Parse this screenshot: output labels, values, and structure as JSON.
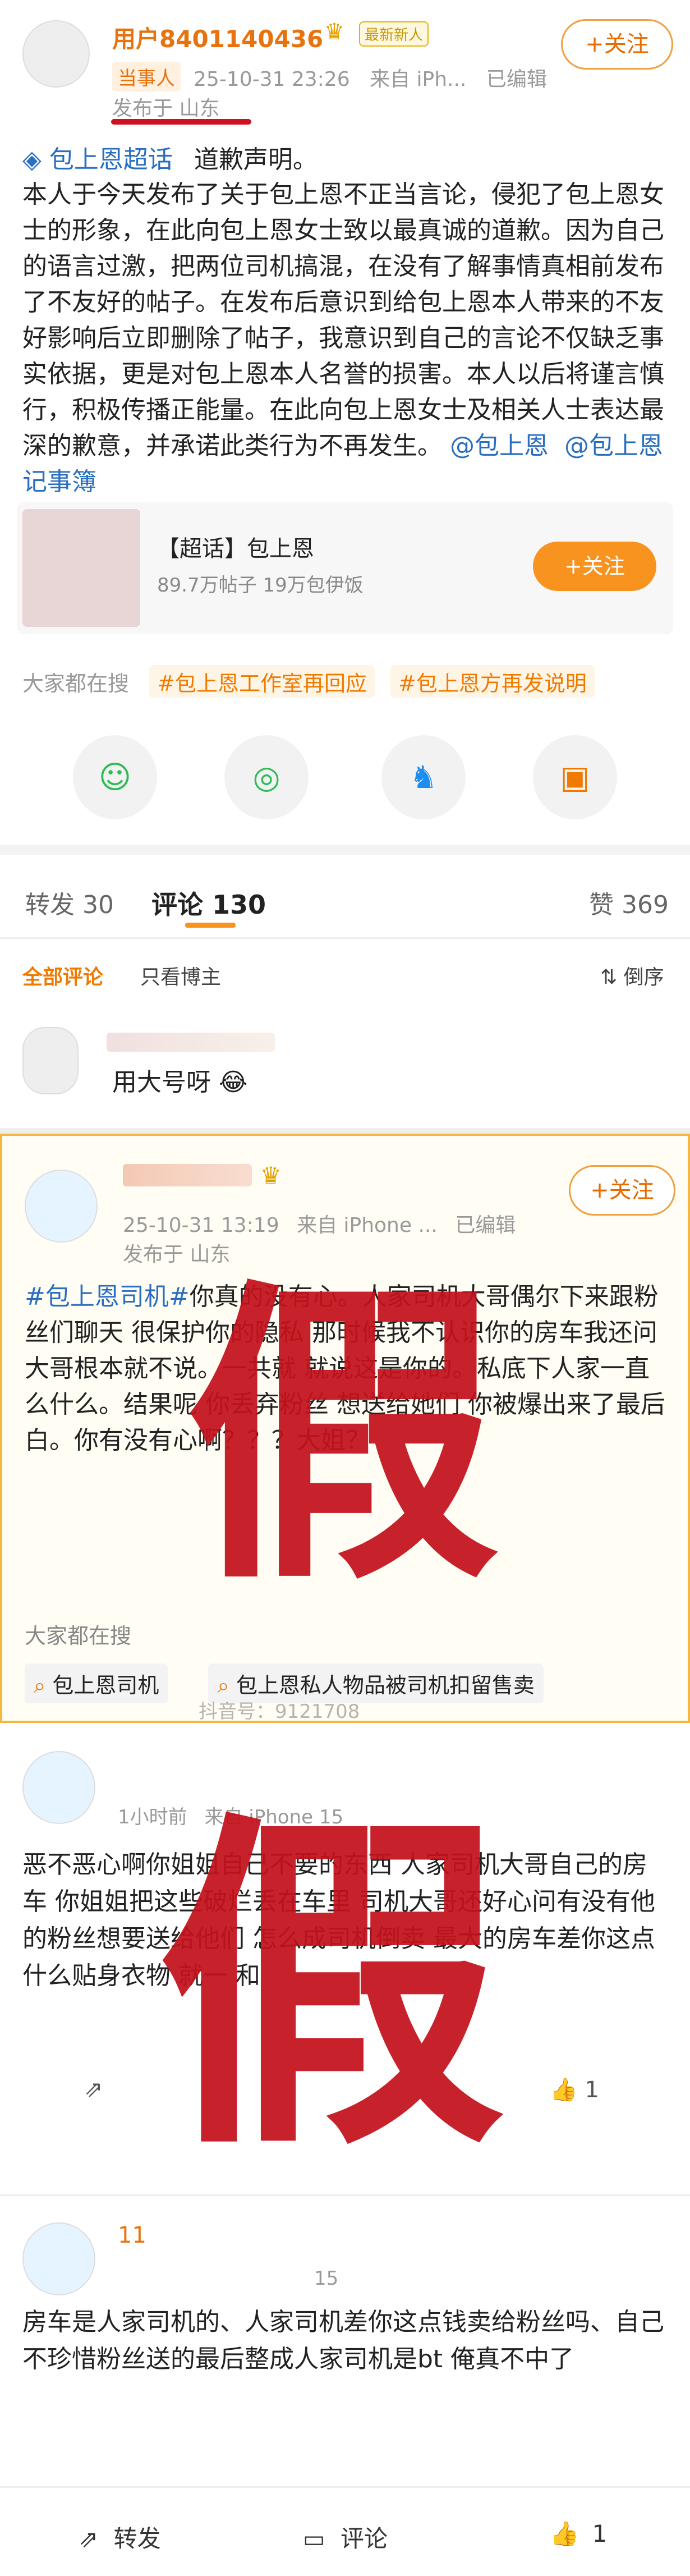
{
  "post": {
    "username": "用户8401140436",
    "user_badge_new": "最新新人",
    "role_tag": "当事人",
    "timestamp": "25-10-31 23:26",
    "source": "来自 iPh...",
    "edited": "已编辑",
    "location": "发布于 山东",
    "follow_label": "+关注",
    "supertopic_tag": "包上恩超话",
    "heading": "道歉声明。",
    "body": "本人于今天发布了关于包上恩不正当言论，侵犯了包上恩女士的形象，在此向包上恩女士致以最真诚的道歉。因为自己的语言过激，把两位司机搞混，在没有了解事情真相前发布了不友好的帖子。在发布后意识到给包上恩本人带来的不友好影响后立即删除了帖子，我意识到自己的言论不仅缺乏事实依据，更是对包上恩本人名誉的损害。本人以后将谨言慎行，积极传播正能量。在此向包上恩女士及相关人士表达最深的歉意，并承诺此类行为不再发生。",
    "mentions": [
      "@包上恩",
      "@包上恩记事簿"
    ],
    "card": {
      "title": "【超话】包上恩",
      "stats": "89.7万帖子 19万包伊饭",
      "follow_label": "+关注"
    },
    "trending_label": "大家都在搜",
    "trending_tags": [
      "#包上恩工作室再回应",
      "#包上恩方再发说明"
    ]
  },
  "tabs": {
    "repost": "转发 30",
    "comment": "评论 130",
    "like": "赞 369"
  },
  "filters": {
    "all": "全部评论",
    "author_only": "只看博主",
    "sort": "倒序"
  },
  "comment1": {
    "text": "用大号呀"
  },
  "fake_post": {
    "timestamp": "25-10-31 13:19",
    "source": "来自 iPhone ...",
    "edited": "已编辑",
    "location": "发布于 山东",
    "follow_label": "+关注",
    "hashtag": "#包上恩司机#",
    "body": "你真的没有心。人家司机大哥偶尔下来跟粉丝们聊天 很保护你的隐私 那时候我不认识你的房车我还问 大哥根本就不说。一共就 就说这是你的。私底下人家一直 么什么。结果呢 你丢弃粉丝 想送给她们 你被爆出来了最后 白。你有没有心啊？？？大姐？",
    "trending_label": "大家都在搜",
    "trending": [
      "包上恩司机",
      "包上恩私人物品被司机扣留售卖"
    ],
    "watermark": "抖音号：9121708"
  },
  "reply1": {
    "time": "1小时前",
    "source": "来自 iPhone 15",
    "text": "恶不恶心啊你姐姐自己不要的东西 人家司机大哥自己的房车 你姐姐把这些破烂丢在车里 司机大哥还好心问有没有他的粉丝想要送给他们 怎么成司机倒卖 最大的房车差你这点 什么贴身衣物 就一 和",
    "like": "1"
  },
  "reply2": {
    "name": "11",
    "source": "15",
    "text": "房车是人家司机的、人家司机差你这点钱卖给粉丝吗、自己不珍惜粉丝送的最后整成人家司机是bt 俺真不中了"
  },
  "bottom": {
    "repost": "转发",
    "comment": "评论",
    "like": "1"
  },
  "fake_label": "假",
  "colors": {
    "accent": "#f07a00",
    "fake": "#c3121c",
    "link": "#2a6fbf"
  }
}
